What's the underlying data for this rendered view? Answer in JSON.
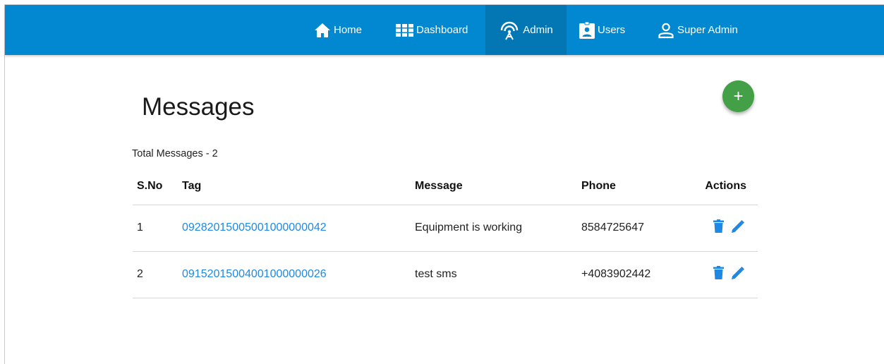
{
  "nav": {
    "items": [
      {
        "label": "Home",
        "icon": "home-icon"
      },
      {
        "label": "Dashboard",
        "icon": "grid-icon"
      },
      {
        "label": "Admin",
        "icon": "antenna-icon",
        "active": true
      },
      {
        "label": "Users",
        "icon": "badge-icon"
      },
      {
        "label": "Super Admin",
        "icon": "person-icon"
      }
    ]
  },
  "page": {
    "title": "Messages",
    "total_label": "Total Messages - 2",
    "add_label": "+"
  },
  "table": {
    "headers": [
      "S.No",
      "Tag",
      "Message",
      "Phone",
      "Actions"
    ],
    "rows": [
      {
        "sno": "1",
        "tag": "09282015005001000000042",
        "message": "Equipment is working",
        "phone": "8584725647"
      },
      {
        "sno": "2",
        "tag": "09152015004001000000026",
        "message": "test sms",
        "phone": "+4083902442"
      }
    ]
  },
  "colors": {
    "navbar": "#0288d1",
    "navbar_active": "#0277b4",
    "fab": "#43a047",
    "link": "#1e88e5"
  }
}
